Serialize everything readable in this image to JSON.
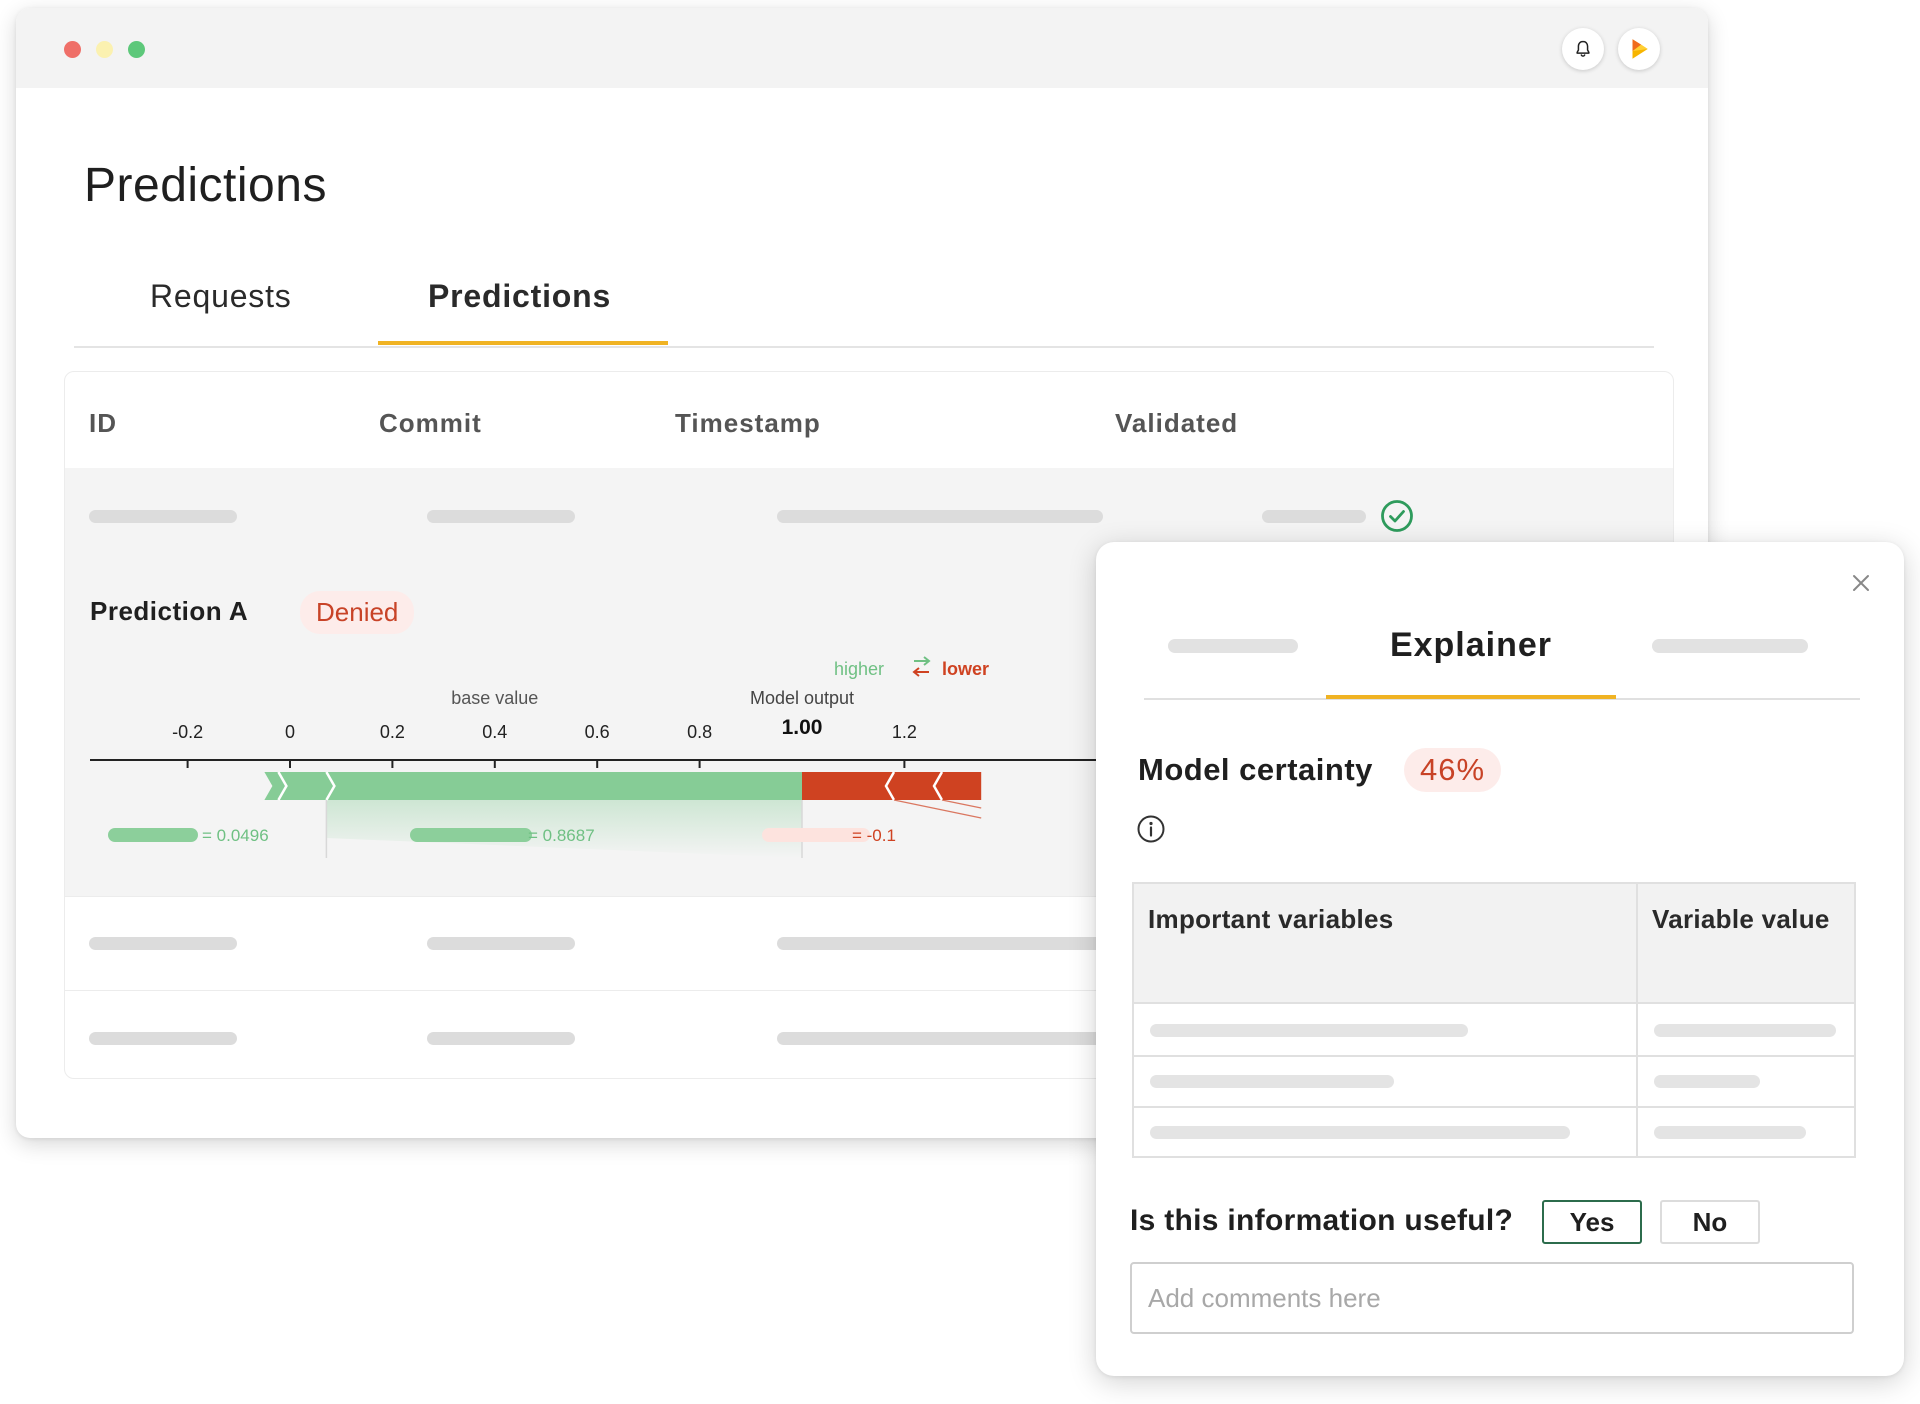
{
  "window": {
    "controls": [
      "close",
      "minimize",
      "maximize"
    ],
    "icons": {
      "notifications": "bell-icon",
      "app": "play-logo-icon"
    }
  },
  "page": {
    "title": "Predictions"
  },
  "tabs": [
    {
      "label": "Requests",
      "active": false
    },
    {
      "label": "Predictions",
      "active": true
    }
  ],
  "table": {
    "headers": {
      "id": "ID",
      "commit": "Commit",
      "timestamp": "Timestamp",
      "validated": "Validated"
    },
    "validated_icon": "check-circle-icon"
  },
  "prediction": {
    "name": "Prediction A",
    "status": "Denied"
  },
  "chart_data": {
    "type": "force-plot",
    "ticks": [
      "-0.2",
      "0",
      "0.2",
      "0.4",
      "0.6",
      "0.8",
      "1.2"
    ],
    "tick_values": [
      -0.2,
      0,
      0.2,
      0.4,
      0.6,
      0.8,
      1.2
    ],
    "base_value_label": "base value",
    "base_value": 0.4,
    "output_label": "Model output",
    "output_value": "1.00",
    "output_numeric": 1.0,
    "legend": {
      "higher": "higher",
      "lower": "lower"
    },
    "positive_range": [
      -0.05,
      1.0
    ],
    "negative_range": [
      1.0,
      1.35
    ],
    "contributions": [
      {
        "label": "= 0.0496",
        "value": 0.0496,
        "direction": "higher"
      },
      {
        "label": "= 0.8687",
        "value": 0.8687,
        "direction": "higher"
      },
      {
        "label": "= -0.1",
        "value": -0.1,
        "direction": "lower"
      }
    ],
    "colors": {
      "higher": "#86cc96",
      "lower": "#cf4221"
    }
  },
  "explainer": {
    "tab_label": "Explainer",
    "certainty_label": "Model certainty",
    "certainty_value": "46%",
    "info_icon": "info-icon",
    "close_icon": "close-icon",
    "variables_table": {
      "headers": {
        "variable": "Important variables",
        "value": "Variable value"
      }
    },
    "feedback": {
      "question": "Is this information useful?",
      "yes": "Yes",
      "no": "No",
      "comments_placeholder": "Add comments here"
    }
  },
  "colors": {
    "accent": "#f0b323",
    "denied_text": "#c84327",
    "denied_bg": "#fdecea",
    "validated": "#2e9b5c"
  }
}
